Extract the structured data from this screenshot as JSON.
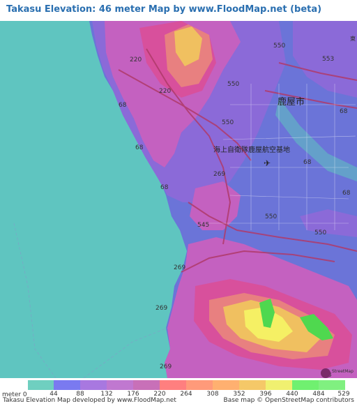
{
  "title": "Takasu Elevation: 46 meter Map by www.FloodMap.net (beta)",
  "map": {
    "road_labels": [
      "220",
      "220",
      "68",
      "68",
      "68",
      "550",
      "550",
      "550",
      "550",
      "553",
      "68",
      "68",
      "68",
      "269",
      "269",
      "269",
      "269",
      "545",
      "550",
      "68"
    ],
    "place_labels": [
      "鹿屋市",
      "海上自衛隊鹿屋航空基地"
    ],
    "corner_label": "東",
    "watermark_text": "StreetMap",
    "colors": {
      "sea": "#5fc5c0",
      "lowland": "#6b74d8",
      "urban": "#8b6ad8",
      "hills": "#c461c0",
      "ridge": "#d8509c",
      "peak_low": "#e88080",
      "peak_mid": "#f0c060",
      "peak_high": "#f5f064",
      "summit": "#4fd84f"
    }
  },
  "legend": {
    "title": "meter 0",
    "labels": [
      "44",
      "88",
      "132",
      "176",
      "220",
      "264",
      "308",
      "352",
      "396",
      "440",
      "484",
      "529"
    ],
    "colors": [
      "#6fcfc0",
      "#7a7af0",
      "#a878e0",
      "#c078d0",
      "#c870b8",
      "#ff7f7f",
      "#ff9a7a",
      "#ffb070",
      "#f5c868",
      "#f0f070",
      "#70f070",
      "#80f080"
    ]
  },
  "footer": {
    "left": "Takasu Elevation Map developed by www.FloodMap.net",
    "right": "Base map © OpenStreetMap contributors"
  }
}
